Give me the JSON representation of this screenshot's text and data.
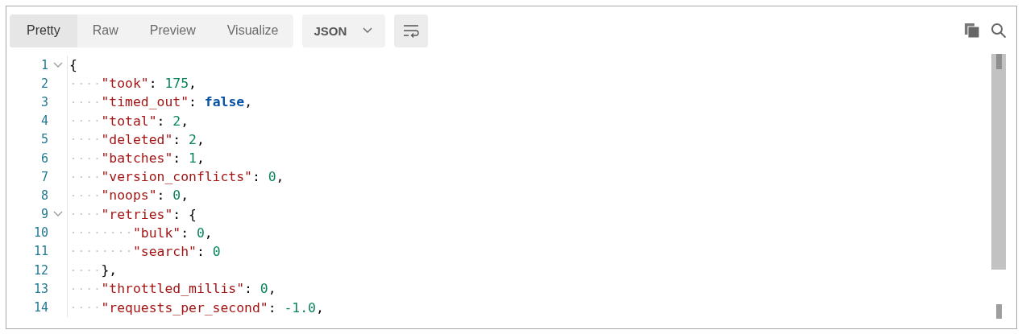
{
  "tabs": [
    {
      "label": "Pretty",
      "selected": true
    },
    {
      "label": "Raw",
      "selected": false
    },
    {
      "label": "Preview",
      "selected": false
    },
    {
      "label": "Visualize",
      "selected": false
    }
  ],
  "format_dropdown": {
    "value": "JSON"
  },
  "code": [
    {
      "number": "1",
      "expanded": true,
      "tokens": [
        {
          "kind": "punct",
          "text": "{"
        }
      ],
      "children": [
        {
          "number": "2",
          "tokens": [
            {
              "kind": "key",
              "text": "\"took\""
            },
            {
              "kind": "punct",
              "text": ": "
            },
            {
              "kind": "number",
              "text": "175"
            },
            {
              "kind": "punct",
              "text": ","
            }
          ]
        },
        {
          "number": "3",
          "tokens": [
            {
              "kind": "key",
              "text": "\"timed_out\""
            },
            {
              "kind": "punct",
              "text": ": "
            },
            {
              "kind": "boolean",
              "text": "false"
            },
            {
              "kind": "punct",
              "text": ","
            }
          ]
        },
        {
          "number": "4",
          "tokens": [
            {
              "kind": "key",
              "text": "\"total\""
            },
            {
              "kind": "punct",
              "text": ": "
            },
            {
              "kind": "number",
              "text": "2"
            },
            {
              "kind": "punct",
              "text": ","
            }
          ]
        },
        {
          "number": "5",
          "tokens": [
            {
              "kind": "key",
              "text": "\"deleted\""
            },
            {
              "kind": "punct",
              "text": ": "
            },
            {
              "kind": "number",
              "text": "2"
            },
            {
              "kind": "punct",
              "text": ","
            }
          ]
        },
        {
          "number": "6",
          "tokens": [
            {
              "kind": "key",
              "text": "\"batches\""
            },
            {
              "kind": "punct",
              "text": ": "
            },
            {
              "kind": "number",
              "text": "1"
            },
            {
              "kind": "punct",
              "text": ","
            }
          ]
        },
        {
          "number": "7",
          "tokens": [
            {
              "kind": "key",
              "text": "\"version_conflicts\""
            },
            {
              "kind": "punct",
              "text": ": "
            },
            {
              "kind": "number",
              "text": "0"
            },
            {
              "kind": "punct",
              "text": ","
            }
          ]
        },
        {
          "number": "8",
          "tokens": [
            {
              "kind": "key",
              "text": "\"noops\""
            },
            {
              "kind": "punct",
              "text": ": "
            },
            {
              "kind": "number",
              "text": "0"
            },
            {
              "kind": "punct",
              "text": ","
            }
          ]
        },
        {
          "number": "9",
          "expanded": true,
          "tokens": [
            {
              "kind": "key",
              "text": "\"retries\""
            },
            {
              "kind": "punct",
              "text": ": {"
            }
          ],
          "children": [
            {
              "number": "10",
              "tokens": [
                {
                  "kind": "key",
                  "text": "\"bulk\""
                },
                {
                  "kind": "punct",
                  "text": ": "
                },
                {
                  "kind": "number",
                  "text": "0"
                },
                {
                  "kind": "punct",
                  "text": ","
                }
              ]
            },
            {
              "number": "11",
              "tokens": [
                {
                  "kind": "key",
                  "text": "\"search\""
                },
                {
                  "kind": "punct",
                  "text": ": "
                },
                {
                  "kind": "number",
                  "text": "0"
                }
              ]
            }
          ]
        },
        {
          "number": "12",
          "tokens": [
            {
              "kind": "punct",
              "text": "},"
            }
          ]
        },
        {
          "number": "13",
          "tokens": [
            {
              "kind": "key",
              "text": "\"throttled_millis\""
            },
            {
              "kind": "punct",
              "text": ": "
            },
            {
              "kind": "number",
              "text": "0"
            },
            {
              "kind": "punct",
              "text": ","
            }
          ]
        },
        {
          "number": "14",
          "tokens": [
            {
              "kind": "key",
              "text": "\"requests_per_second\""
            },
            {
              "kind": "punct",
              "text": ": "
            },
            {
              "kind": "number",
              "text": "-1.0"
            },
            {
              "kind": "punct",
              "text": ","
            }
          ]
        }
      ]
    }
  ]
}
